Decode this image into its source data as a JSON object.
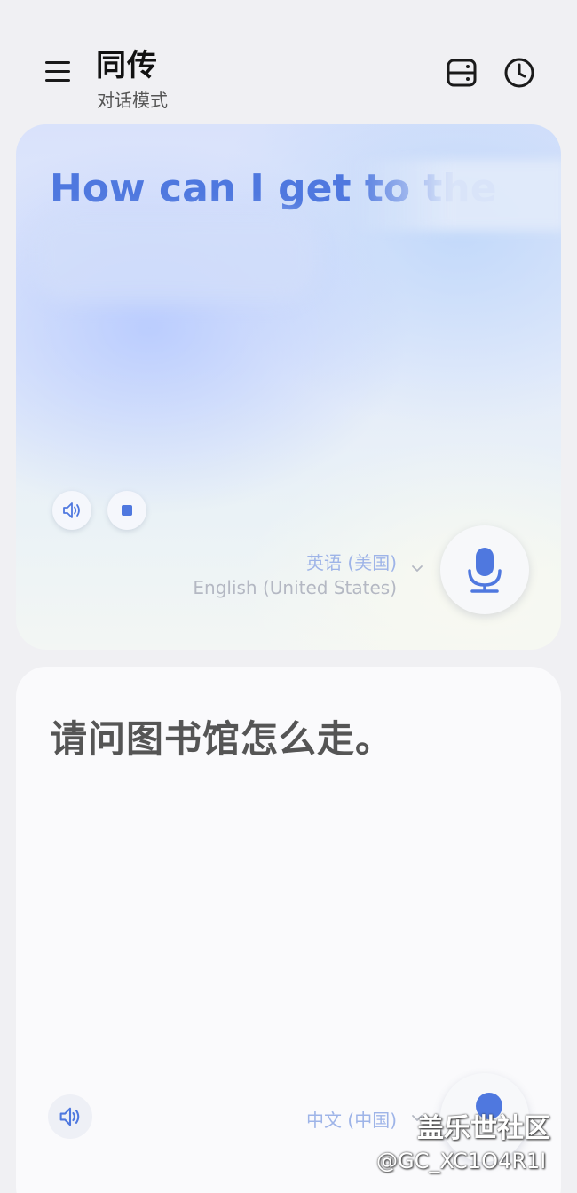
{
  "header": {
    "menu_icon": "menu-icon",
    "title": "同传",
    "subtitle": "对话模式",
    "layout_icon": "split-screen-icon",
    "history_icon": "clock-icon"
  },
  "source_panel": {
    "text": "How can I get to the",
    "speaker_icon": "speaker-icon",
    "stop_icon": "stop-icon",
    "language_primary": "英语 (美国)",
    "language_secondary": "English (United States)",
    "chevron_icon": "chevron-down-icon",
    "mic_icon": "microphone-icon"
  },
  "target_panel": {
    "text": "请问图书馆怎么走。",
    "speaker_icon": "speaker-icon",
    "language_primary": "中文 (中国)",
    "chevron_icon": "chevron-down-icon",
    "mic_icon": "microphone-icon"
  },
  "watermark": {
    "title": "盖乐世社区",
    "handle": "@GC_XC1O4R1I"
  },
  "colors": {
    "accent": "#4f78df",
    "background": "#f0f0f3"
  }
}
